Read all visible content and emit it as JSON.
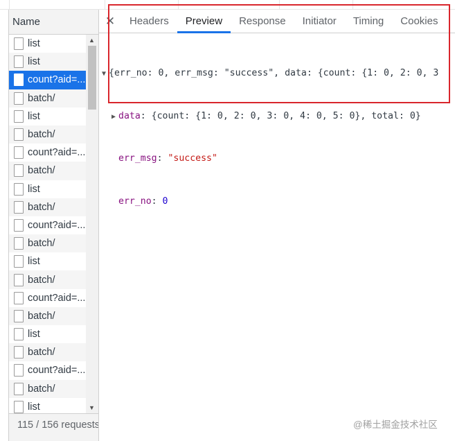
{
  "network": {
    "name_column_header": "Name",
    "requests": [
      {
        "label": "list"
      },
      {
        "label": "list"
      },
      {
        "label": "count?aid=...",
        "selected": true
      },
      {
        "label": "batch/"
      },
      {
        "label": "list"
      },
      {
        "label": "batch/"
      },
      {
        "label": "count?aid=..."
      },
      {
        "label": "batch/"
      },
      {
        "label": "list"
      },
      {
        "label": "batch/"
      },
      {
        "label": "count?aid=..."
      },
      {
        "label": "batch/"
      },
      {
        "label": "list"
      },
      {
        "label": "batch/"
      },
      {
        "label": "count?aid=..."
      },
      {
        "label": "batch/"
      },
      {
        "label": "list"
      },
      {
        "label": "batch/"
      },
      {
        "label": "count?aid=..."
      },
      {
        "label": "batch/"
      },
      {
        "label": "list"
      }
    ],
    "status": "115 / 156 requests"
  },
  "details": {
    "tabs": [
      {
        "label": "Headers"
      },
      {
        "label": "Preview",
        "active": true
      },
      {
        "label": "Response"
      },
      {
        "label": "Initiator"
      },
      {
        "label": "Timing"
      },
      {
        "label": "Cookies"
      }
    ],
    "preview": {
      "summary": "{err_no: 0, err_msg: \"success\", data: {count: {1: 0, 2: 0, 3",
      "data_key": "data",
      "data_value": "{count: {1: 0, 2: 0, 3: 0, 4: 0, 5: 0}, total: 0}",
      "err_msg_key": "err_msg",
      "err_msg_value": "\"success\"",
      "err_no_key": "err_no",
      "err_no_value": "0"
    }
  },
  "watermark": "@稀土掘金技术社区",
  "colors": {
    "accent": "#1a73e8",
    "highlight_border": "#d9262c",
    "json_key": "#881280",
    "json_string": "#c41a16",
    "json_number": "#1c00cf"
  }
}
